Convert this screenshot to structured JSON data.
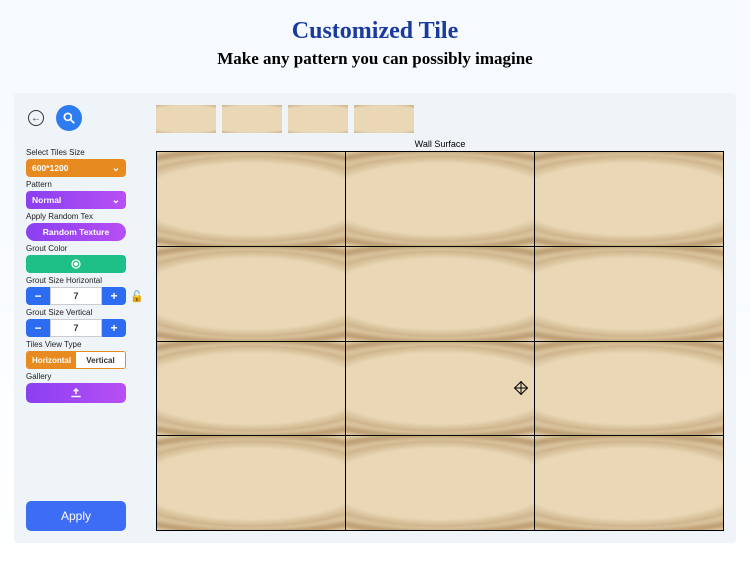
{
  "header": {
    "title": "Customized Tile",
    "subtitle": "Make any pattern you can possibly imagine"
  },
  "sidebar": {
    "select_tiles_size_label": "Select Tiles Size",
    "tiles_size_value": "600*1200",
    "pattern_label": "Pattern",
    "pattern_value": "Normal",
    "apply_random_label": "Apply Random Tex",
    "random_texture_btn": "Random Texture",
    "grout_color_label": "Grout Color",
    "grout_h_label": "Grout Size Horizontal",
    "grout_h_value": "7",
    "grout_v_label": "Grout Size Vertical",
    "grout_v_value": "7",
    "tiles_view_type_label": "Tiles View Type",
    "view_horizontal": "Horizontal",
    "view_vertical": "Vertical",
    "gallery_label": "Gallery",
    "apply_btn": "Apply"
  },
  "main": {
    "surface_label": "Wall Surface"
  }
}
